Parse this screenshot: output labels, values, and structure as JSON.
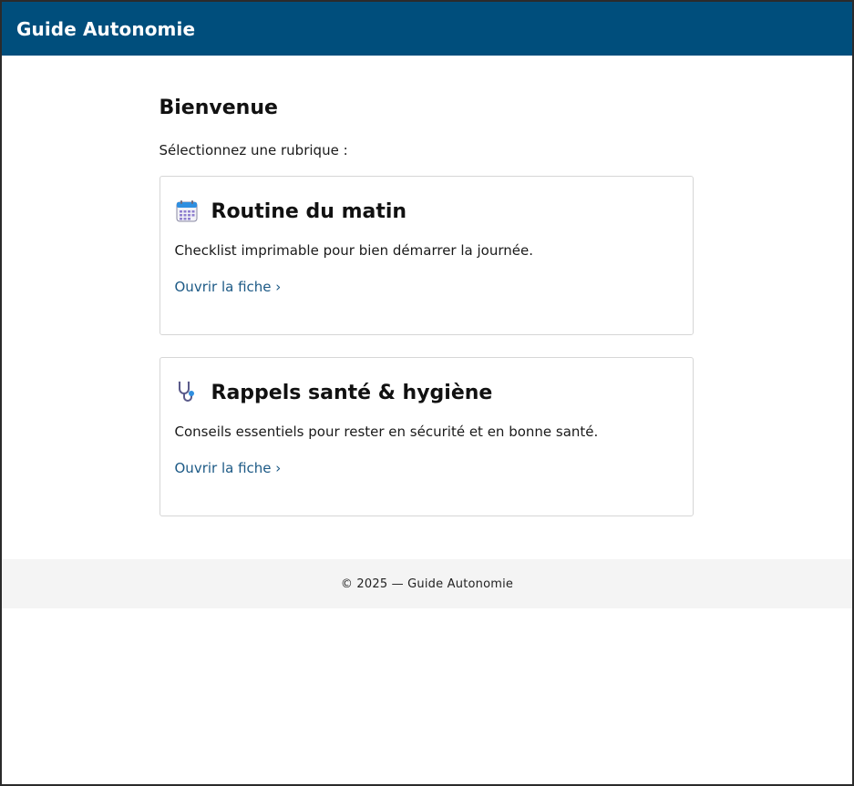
{
  "header": {
    "title": "Guide Autonomie"
  },
  "main": {
    "title": "Bienvenue",
    "intro": "Sélectionnez une rubrique :",
    "cards": [
      {
        "icon": "calendar-icon",
        "title": "Routine du matin",
        "description": "Checklist imprimable pour bien démarrer la journée.",
        "link": "Ouvrir la fiche ›"
      },
      {
        "icon": "stethoscope-icon",
        "title": "Rappels santé & hygiène",
        "description": "Conseils essentiels pour rester en sécurité et en bonne santé.",
        "link": "Ouvrir la fiche ›"
      }
    ]
  },
  "footer": {
    "text": "© 2025 — Guide Autonomie"
  },
  "colors": {
    "header_bg": "#004e7c",
    "link": "#1d5a86",
    "footer_bg": "#f4f4f4",
    "card_border": "#d6d6d6"
  }
}
